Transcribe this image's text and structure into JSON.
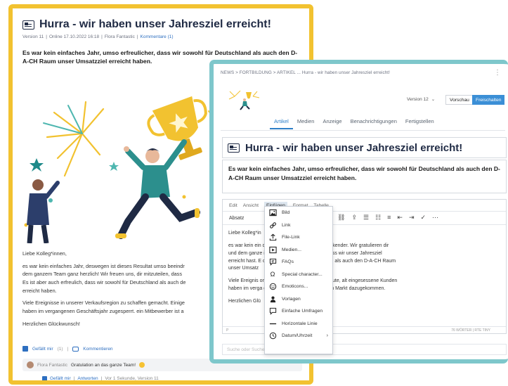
{
  "left": {
    "title": "Hurra - wir haben unser Jahresziel erreicht!",
    "meta": {
      "version": "Version 11",
      "sep1": "|",
      "online": "Online 17.10.2022 16:18",
      "sep2": "|",
      "author": "Flora Fantastic",
      "sep3": "|",
      "comments": "Kommentare (1)"
    },
    "lead": "Es war kein einfaches Jahr, umso erfreulicher, dass wir sowohl für Deutschland als auch den D-A-CH Raum unser Umsatzziel erreicht haben.",
    "body": [
      "Liebe Kolleg*innen,",
      "es war kein einfaches Jahr, deswegen ist dieses Resultat umso beeindr",
      "dem ganzem Team ganz herzlich! Wir freuen uns, dir mitzuteilen, dass",
      "Es ist aber auch erfreulich, dass wir sowohl für Deutschland als auch de",
      "erreicht haben.",
      "Viele Ereignisse in unserer Verkaufsregion zu schaffen gemacht. Einige",
      "haben im vergangenen Geschäftsjahr zugesperrt. ein Mitbewerber ist a",
      "Herzlichen Glückwunsch!"
    ],
    "actions": {
      "like": "Gefällt mir",
      "like_count": "(1)",
      "sep": "|",
      "comments": "Kommentieren"
    },
    "comment": {
      "author": "Flora Fantastic",
      "text": "Gratulation an das ganze Team!"
    },
    "comment_actions": {
      "like": "Gefällt mir",
      "sep1": "|",
      "reply": "Antworten",
      "sep2": "|",
      "time": "Vor 1 Sekunde, Version 11"
    }
  },
  "right": {
    "breadcrumb": "NEWS  >  FORTBILDUNG  >  ARTIKEL ... Hurra - wir haben unser Jahresziel erreicht!",
    "more": "⋮",
    "version": "Version 12",
    "preview_label": "Vorschau",
    "publish_label": "Freischalten",
    "tabs": [
      "Artikel",
      "Medien",
      "Anzeige",
      "Benachrichtigungen",
      "Fertigstellen"
    ],
    "title": "Hurra - wir haben unser Jahresziel erreicht!",
    "lead": "Es war kein einfaches Jahr, umso erfreulicher, dass wir sowohl für Deutschland als auch den D-A-CH Raum unser Umsatzziel erreicht haben.",
    "menubar": [
      "Edit",
      "Ansicht",
      "Einfügen",
      "Format",
      "Tabelle"
    ],
    "format_select": "Absatz",
    "content": [
      "Liebe Kolleg*in",
      "es war kein ein                                       dieses Resultat umso beeindruckender. Wir gratulieren dir",
      "und dem ganze                                         ir freuen uns, dir mitzuteilen, dass  wir unser Jahresziel",
      "erreicht hast. E                                        dass wir sowohl für Deutschland als auch den D-A-CH Raum",
      "unser Umsatz",
      "Viele Ereignis                                         on zu schaffen gemacht. Einige gute, alt eingesessene Kunden",
      "haben im verga                                        gesperrt. ein Mitbewerber ist am Markt dazugekommen.",
      "Herzlichen Glü"
    ],
    "status_p": "P",
    "status_words": "76 WÖRTER | RTE TINY",
    "search_placeholder": "Suche oder Suche..."
  },
  "dropdown": [
    {
      "label": "Bild",
      "icon": "image-icon"
    },
    {
      "label": "Link",
      "icon": "link-icon"
    },
    {
      "label": "File-Link",
      "icon": "upload-icon"
    },
    {
      "label": "Medien...",
      "icon": "media-icon"
    },
    {
      "label": "FAQs",
      "icon": "faq-icon"
    },
    {
      "label": "Special character...",
      "icon": "omega-icon"
    },
    {
      "label": "Emoticons...",
      "icon": "emoticon-icon"
    },
    {
      "label": "Vorlagen",
      "icon": "template-icon"
    },
    {
      "label": "Einfache Umfragen",
      "icon": "poll-icon"
    },
    {
      "label": "Horizontale Linie",
      "icon": "hr-icon"
    },
    {
      "label": "Datum/Uhrzeit",
      "icon": "clock-icon",
      "submenu": "›"
    }
  ],
  "colors": {
    "left_border": "#f2c230",
    "right_border": "#7ec7cb",
    "accent_blue": "#2e7fc8",
    "publish_button": "#3b8fd6"
  }
}
